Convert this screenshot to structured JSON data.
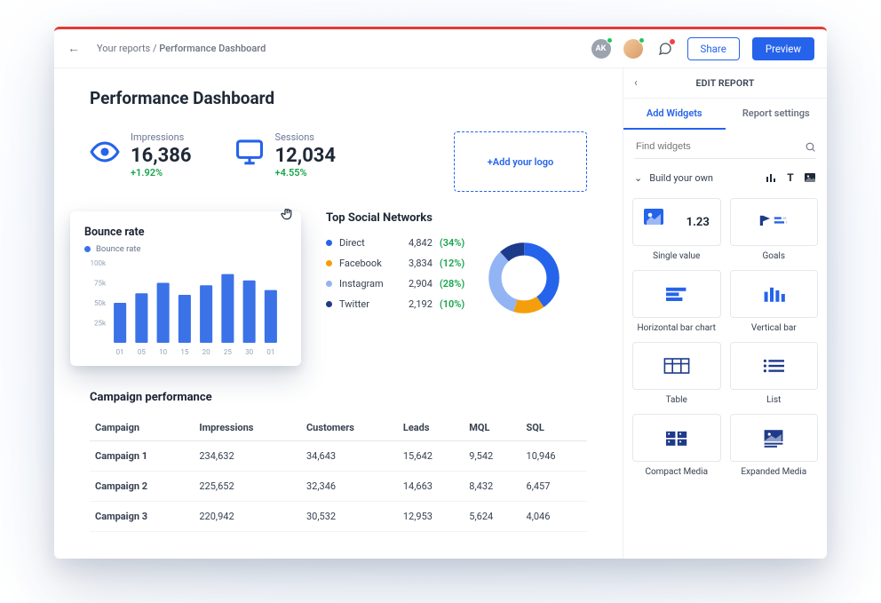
{
  "topbar": {
    "breadcrumb_prefix": "Your reports",
    "breadcrumb_sep": " / ",
    "breadcrumb_current": "Performance Dashboard",
    "avatar_initials": "AK",
    "share_label": "Share",
    "preview_label": "Preview"
  },
  "page_title": "Performance Dashboard",
  "kpis": {
    "impressions": {
      "label": "Impressions",
      "value": "16,386",
      "delta": "+1.92%"
    },
    "sessions": {
      "label": "Sessions",
      "value": "12,034",
      "delta": "+4.55%"
    }
  },
  "logo_box_label": "+Add your logo",
  "chart_data": {
    "type": "bar",
    "title": "Bounce rate",
    "legend": "Bounce rate",
    "ylabel": "",
    "yticks": [
      "25k",
      "50k",
      "75k",
      "100k"
    ],
    "ylim": [
      0,
      100
    ],
    "categories": [
      "01",
      "05",
      "10",
      "15",
      "20",
      "25",
      "30",
      "01"
    ],
    "values": [
      50,
      62,
      75,
      60,
      72,
      86,
      78,
      66
    ]
  },
  "social": {
    "title": "Top Social Networks",
    "items": [
      {
        "name": "Direct",
        "value": "4,842",
        "pct": "(34%)",
        "color": "#2563eb"
      },
      {
        "name": "Facebook",
        "value": "3,834",
        "pct": "(12%)",
        "color": "#f59e0b"
      },
      {
        "name": "Instagram",
        "value": "2,904",
        "pct": "(28%)",
        "color": "#93b4f3"
      },
      {
        "name": "Twitter",
        "value": "2,192",
        "pct": "(10%)",
        "color": "#1e3a8a"
      }
    ]
  },
  "campaign": {
    "title": "Campaign performance",
    "headers": [
      "Campaign",
      "Impressions",
      "Customers",
      "Leads",
      "MQL",
      "SQL"
    ],
    "rows": [
      [
        "Campaign 1",
        "234,632",
        "34,643",
        "15,642",
        "9,542",
        "10,946"
      ],
      [
        "Campaign 2",
        "225,652",
        "32,346",
        "14,663",
        "8,432",
        "6,457"
      ],
      [
        "Campaign 3",
        "220,942",
        "30,532",
        "12,953",
        "5,624",
        "4,046"
      ]
    ]
  },
  "panel": {
    "title": "EDIT REPORT",
    "tab_add": "Add Widgets",
    "tab_settings": "Report settings",
    "search_placeholder": "Find widgets",
    "build_label": "Build your own",
    "widgets": [
      "Single value",
      "Goals",
      "Horizontal bar chart",
      "Vertical bar",
      "Table",
      "List",
      "Compact Media",
      "Expanded Media"
    ]
  }
}
